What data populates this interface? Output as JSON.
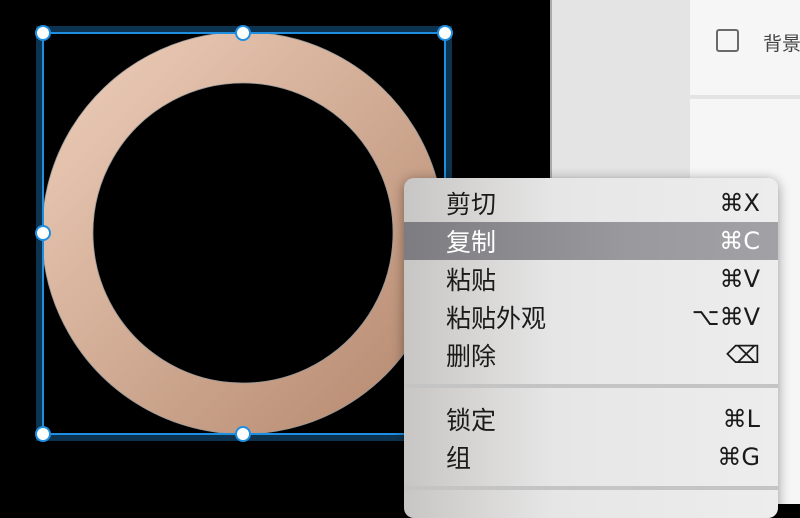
{
  "panel": {
    "background_label": "背景"
  },
  "menu": {
    "groups": [
      [
        {
          "label": "剪切",
          "shortcut": "⌘X"
        },
        {
          "label": "复制",
          "shortcut": "⌘C",
          "highlighted": true
        },
        {
          "label": "粘贴",
          "shortcut": "⌘V"
        },
        {
          "label": "粘贴外观",
          "shortcut": "⌥⌘V"
        },
        {
          "label": "删除",
          "shortcut": "⌫"
        }
      ],
      [
        {
          "label": "锁定",
          "shortcut": "⌘L"
        },
        {
          "label": "组",
          "shortcut": "⌘G"
        }
      ]
    ]
  },
  "colors": {
    "selection": "#1e8fe0",
    "ring_light": "#ecc9b3",
    "ring_dark": "#b98c73",
    "highlight": "#8a898d"
  }
}
